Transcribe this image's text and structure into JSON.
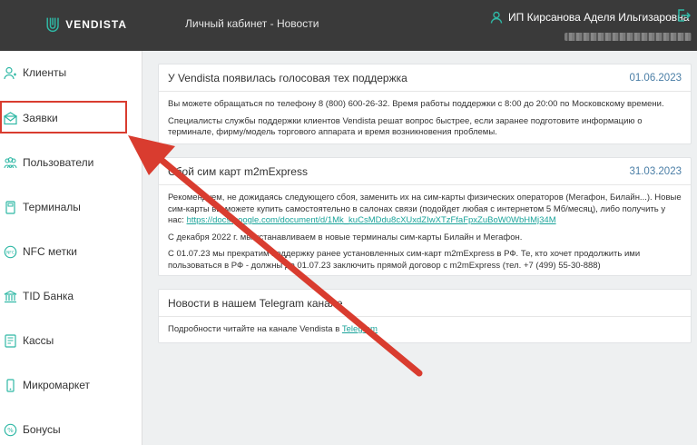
{
  "header": {
    "logo_text": "VENDISTA",
    "page_title": "Личный кабинет - Новости",
    "user_name": "ИП Кирсанова Аделя Ильгизаровна"
  },
  "sidebar": {
    "items": [
      {
        "label": "Клиенты",
        "icon": "clients-icon"
      },
      {
        "label": "Заявки",
        "icon": "requests-icon"
      },
      {
        "label": "Пользователи",
        "icon": "users-icon"
      },
      {
        "label": "Терминалы",
        "icon": "terminal-icon"
      },
      {
        "label": "NFC метки",
        "icon": "nfc-icon"
      },
      {
        "label": "TID Банка",
        "icon": "bank-icon"
      },
      {
        "label": "Кассы",
        "icon": "cash-register-icon"
      },
      {
        "label": "Микромаркет",
        "icon": "micromarket-icon"
      },
      {
        "label": "Бонусы",
        "icon": "bonus-icon"
      }
    ]
  },
  "news": [
    {
      "title": "У Vendista появилась голосовая тех поддержка",
      "date": "01.06.2023",
      "p1": "Вы можете обращаться по телефону 8 (800) 600-26-32. Время работы поддержки с 8:00 до 20:00 по Московскому времени.",
      "p2": "Специалисты службы поддержки клиентов Vendista решат вопрос быстрее, если заранее подготовите информацию о терминале, фирму/модель торгового аппарата и время возникновения проблемы."
    },
    {
      "title": "Сбой сим карт m2mExpress",
      "date": "31.03.2023",
      "p1": "Рекомендуем, не дожидаясь следующего сбоя, заменить их на сим-карты физических операторов (Мегафон, Билайн...). Новые сим-карты вы можете купить самостоятельно в салонах связи (подойдет любая с интернетом 5 Мб/месяц), либо получить у нас:",
      "p1_link": "https://docs.google.com/document/d/1Mk_kuCsMDdu8cXUxdZIwXTzFfaFpxZuBoW0WbHMj34M",
      "p2": "С декабря 2022 г. мы устанавливаем в новые терминалы сим-карты Билайн и Мегафон.",
      "p3": "С 01.07.23 мы прекратим поддержку ранее установленных сим-карт m2mExpress в РФ. Те, кто хочет продолжить ими пользоваться в РФ - должны до 01.07.23 заключить прямой договор с m2mExpress (тел. +7 (499) 55-30-888)"
    },
    {
      "title": "Новости в нашем Telegram канале",
      "p1": "Подробности читайте на канале Vendista в",
      "p1_link": "Telegram"
    }
  ],
  "colors": {
    "topbar": "#3a3a3a",
    "accent": "#1aa39a",
    "date": "#4a7ea6",
    "annotation": "#d93c2f"
  }
}
